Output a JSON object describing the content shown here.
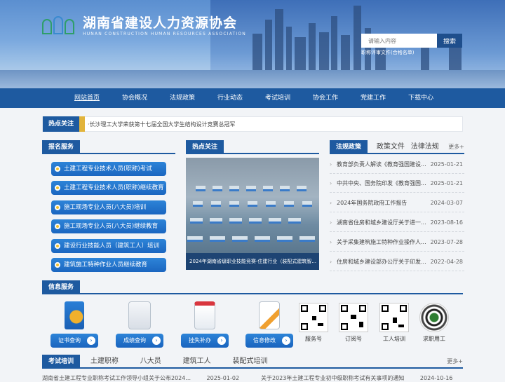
{
  "header": {
    "title": "湖南省建设人力资源协会",
    "subtitle": "HUNAN CONSTRUCTION HUMAN RESOURCES ASSOCIATION",
    "search_placeholder": "请输入内容",
    "search_button": "搜索",
    "search_hint": "职称评审文件(合格名单)"
  },
  "nav": [
    "网站首页",
    "协会概况",
    "法规政策",
    "行业动态",
    "考试培训",
    "协会工作",
    "党建工作",
    "下载中心"
  ],
  "hot_bar": {
    "label": "热点关注",
    "text": "·长沙理工大学荣获第十七届全国大学生结构设计竞赛总冠军"
  },
  "signup": {
    "title": "报名服务",
    "items": [
      "土建工程专业技术人员(职称)考试",
      "土建工程专业技术人员(职称)继续教育",
      "施工现场专业人员(八大员)培训",
      "施工现场专业人员(八大员)继续教育",
      "建设行业技能人员（建筑工人）培训",
      "建筑施工特种作业人员继续教育"
    ]
  },
  "hot_focus": {
    "title": "热点关注",
    "caption": "2024年湖南省级职业技能竞赛-住建行业（装配式建筑智..."
  },
  "policy": {
    "tabs": [
      "法规政策",
      "政策文件",
      "法律法规"
    ],
    "more": "更多+",
    "items": [
      {
        "title": "教育部负责人解读《教育强国建设...",
        "date": "2025-01-21"
      },
      {
        "title": "中共中央、国务院印发《教育强国...",
        "date": "2025-01-21"
      },
      {
        "title": "2024年国务院政府工作报告",
        "date": "2024-03-07"
      },
      {
        "title": "湖南省住房和城乡建设厅关于进一...",
        "date": "2023-08-16"
      },
      {
        "title": "关于采集建筑施工特种作业操作人...",
        "date": "2023-07-28"
      },
      {
        "title": "住房和城乡建设部办公厅关于印发...",
        "date": "2022-04-28"
      }
    ]
  },
  "info": {
    "title": "信息服务",
    "buttons": [
      "证书查询",
      "成绩查询",
      "挂失补办",
      "信息修改"
    ],
    "qrs": [
      "服务号",
      "订阅号",
      "工人培训",
      "求职用工"
    ]
  },
  "exam": {
    "tabs": [
      "考试培训",
      "土建职称",
      "八大员",
      "建筑工人",
      "装配式培训"
    ],
    "more": "更多+",
    "row_left": "湖南省土建工程专业职称考试工作领导小组关于公布2024...",
    "row_left_date": "2025-01-02",
    "row_right": "关于2023年土建工程专业初中级职称考试有关事项的通知",
    "row_right_date": "2024-10-16"
  },
  "colors": {
    "primary": "#1e5aa0",
    "button": "#1b66c0",
    "accent": "#e2b43b"
  }
}
